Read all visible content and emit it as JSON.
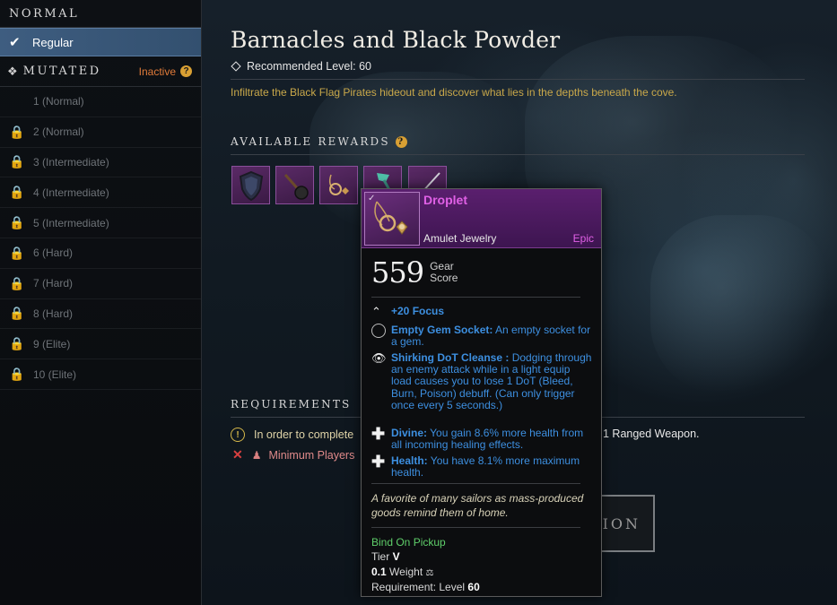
{
  "sidebar": {
    "normal_header": "NORMAL",
    "regular_label": "Regular",
    "mutated_header": "MUTATED",
    "mutated_status": "Inactive",
    "levels": [
      {
        "label": "1  (Normal)",
        "locked": false
      },
      {
        "label": "2  (Normal)",
        "locked": true
      },
      {
        "label": "3  (Intermediate)",
        "locked": true
      },
      {
        "label": "4  (Intermediate)",
        "locked": true
      },
      {
        "label": "5  (Intermediate)",
        "locked": true
      },
      {
        "label": "6  (Hard)",
        "locked": true
      },
      {
        "label": "7  (Hard)",
        "locked": true
      },
      {
        "label": "8  (Hard)",
        "locked": true
      },
      {
        "label": "9  (Elite)",
        "locked": true
      },
      {
        "label": "10  (Elite)",
        "locked": true
      }
    ]
  },
  "expedition": {
    "title": "Barnacles and Black Powder",
    "recommended_level": "Recommended Level: 60",
    "description": "Infiltrate the Black Flag Pirates hideout and discover what lies in the depths beneath the cove."
  },
  "rewards": {
    "header": "AVAILABLE REWARDS",
    "items": [
      "shield-icon",
      "mace-icon",
      "amulet-icon",
      "hatchet-icon",
      "rapier-icon"
    ]
  },
  "requirements": {
    "header": "REQUIREMENTS",
    "line1_prefix": "In order to complete",
    "line1_suffix": "1 Ranged Weapon.",
    "line2": "Minimum Players"
  },
  "play_button_partial": "ION",
  "tooltip": {
    "name": "Droplet",
    "type": "Amulet Jewelry",
    "rarity": "Epic",
    "gear_score": "559",
    "gear_score_label_1": "Gear",
    "gear_score_label_2": "Score",
    "attribute": "+20 Focus",
    "perks": [
      {
        "icon": "gem-socket-icon",
        "name": "Empty Gem Socket:",
        "desc": " An empty socket for a gem."
      },
      {
        "icon": "eye-icon",
        "name": "Shirking DoT Cleanse :",
        "desc": " Dodging through an enemy attack while in a light equip load causes you to lose 1 DoT (Bleed, Burn, Poison) debuff. (Can only trigger once every 5 seconds.)"
      },
      {
        "icon": "plus-icon",
        "name": "Divine:",
        "desc": " You gain 8.6% more health from all incoming healing effects."
      },
      {
        "icon": "plus-icon",
        "name": "Health:",
        "desc": " You have 8.1% more maximum health."
      }
    ],
    "flavor": "A favorite of many sailors as mass-produced goods remind them of home.",
    "bind": "Bind On Pickup",
    "tier_label": "Tier",
    "tier_value": "V",
    "weight_value": "0.1",
    "weight_label": "Weight",
    "requirement_label": "Requirement:  Level",
    "requirement_value": "60"
  },
  "colors": {
    "epic": "#e060e6",
    "perk_blue": "#3d8fe0",
    "gold": "#c9a84a",
    "inactive": "#e07b39",
    "bind_green": "#5fcf6a",
    "selected_row": "#3e5d80"
  }
}
